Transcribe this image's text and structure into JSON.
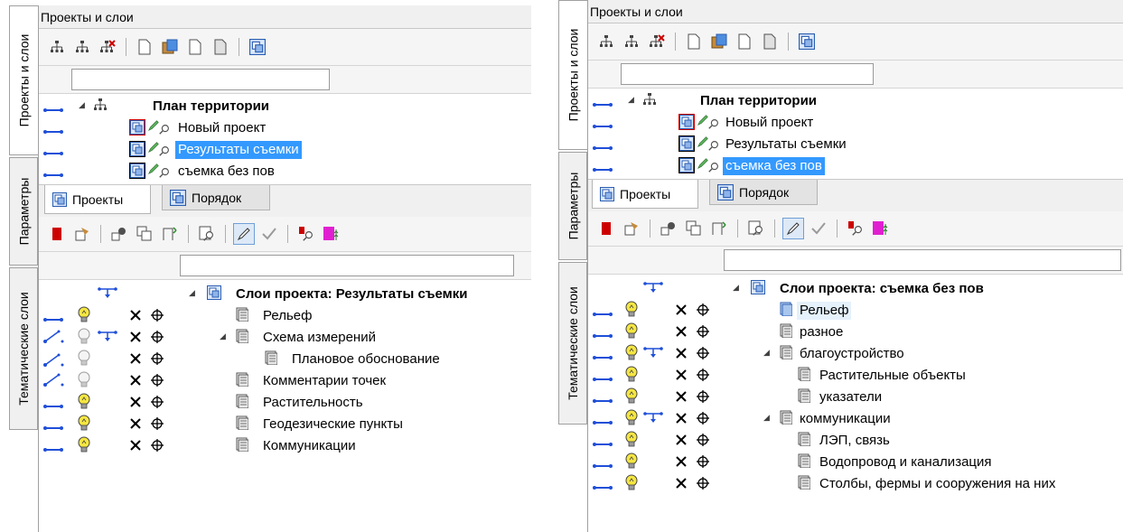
{
  "left": {
    "vertical_tabs": [
      "Проекты и слои",
      "Параметры",
      "Тематические слои"
    ],
    "panel_title": "Проекты и слои",
    "projects": {
      "root": "План территории",
      "items": [
        "Новый проект",
        "Результаты съемки",
        "съемка без пов"
      ],
      "selected": "Результаты съемки"
    },
    "subtabs": [
      "Проекты",
      "Порядок"
    ],
    "layers": {
      "root": "Слои проекта: Результаты съемки",
      "items": [
        "Рельеф",
        "Схема измерений",
        "Плановое обоснование",
        "Комментарии точек",
        "Растительность",
        "Геодезические пункты",
        "Коммуникации"
      ]
    }
  },
  "right": {
    "vertical_tabs": [
      "Проекты и слои",
      "Параметры",
      "Тематические слои"
    ],
    "panel_title": "Проекты и слои",
    "projects": {
      "root": "План территории",
      "items": [
        "Новый проект",
        "Результаты съемки",
        "съемка без пов"
      ],
      "selected": "съемка без пов"
    },
    "subtabs": [
      "Проекты",
      "Порядок"
    ],
    "layers": {
      "root": "Слои проекта: съемка без пов",
      "items": [
        "Рельеф",
        "разное",
        "благоустройство",
        "Растительные объекты",
        "указатели",
        "коммуникации",
        "ЛЭП, связь",
        "Водопровод и канализация",
        "Столбы, фермы и сооружения на них"
      ]
    }
  },
  "icons": {
    "delete": "×",
    "snap": "⊕",
    "expand_arrow": "◢",
    "collapse_arrow": "▷"
  },
  "colors": {
    "selection": "#3399ff",
    "bulb": "#f5e642",
    "link": "#1f4fd8",
    "red_flag": "#cc0000",
    "magenta": "#e020d0"
  }
}
